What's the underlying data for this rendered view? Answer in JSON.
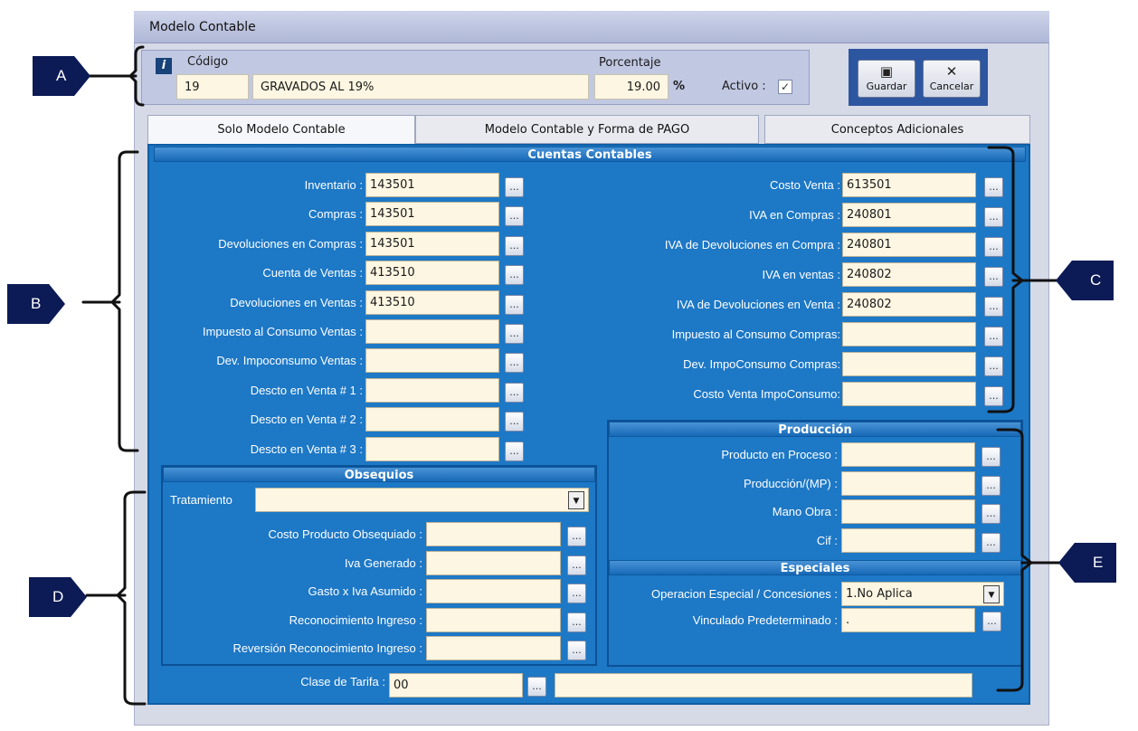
{
  "window": {
    "title": "Modelo Contable"
  },
  "header": {
    "codigo_label": "Código",
    "porcentaje_label": "Porcentaje",
    "codigo_value": "19",
    "descripcion_value": "GRAVADOS AL 19%",
    "porcentaje_value": "19.00",
    "percent_sign": "%",
    "activo_label": "Activo :",
    "activo_checked": true
  },
  "toolbar": {
    "save_label": "Guardar",
    "cancel_label": "Cancelar"
  },
  "tabs": [
    {
      "label": "Solo Modelo Contable",
      "active": true
    },
    {
      "label": "Modelo Contable y Forma de PAGO",
      "active": false
    },
    {
      "label": "Conceptos Adicionales",
      "active": false
    }
  ],
  "cuentas": {
    "title": "Cuentas Contables",
    "left": [
      {
        "label": "Inventario :",
        "value": "143501"
      },
      {
        "label": "Compras :",
        "value": "143501"
      },
      {
        "label": "Devoluciones en Compras :",
        "value": "143501"
      },
      {
        "label": "Cuenta de Ventas :",
        "value": "413510"
      },
      {
        "label": "Devoluciones en Ventas :",
        "value": "413510"
      },
      {
        "label": "Impuesto al Consumo Ventas :",
        "value": ""
      },
      {
        "label": "Dev. Impoconsumo Ventas :",
        "value": ""
      },
      {
        "label": "Descto en Venta # 1 :",
        "value": ""
      },
      {
        "label": "Descto en Venta # 2 :",
        "value": ""
      },
      {
        "label": "Descto en Venta # 3 :",
        "value": ""
      }
    ],
    "right": [
      {
        "label": "Costo Venta :",
        "value": "613501"
      },
      {
        "label": "IVA en Compras :",
        "value": "240801"
      },
      {
        "label": "IVA de Devoluciones en Compra :",
        "value": "240801"
      },
      {
        "label": "IVA en ventas :",
        "value": "240802"
      },
      {
        "label": "IVA de Devoluciones en Venta :",
        "value": "240802"
      },
      {
        "label": "Impuesto al Consumo Compras:",
        "value": ""
      },
      {
        "label": "Dev. ImpoConsumo Compras:",
        "value": ""
      },
      {
        "label": "Costo Venta ImpoConsumo:",
        "value": ""
      }
    ]
  },
  "obsequios": {
    "title": "Obsequios",
    "tratamiento_label": "Tratamiento",
    "tratamiento_value": "",
    "fields": [
      {
        "label": "Costo Producto Obsequiado :",
        "value": ""
      },
      {
        "label": "Iva Generado :",
        "value": ""
      },
      {
        "label": "Gasto x Iva Asumido :",
        "value": ""
      },
      {
        "label": "Reconocimiento Ingreso :",
        "value": ""
      },
      {
        "label": "Reversión Reconocimiento Ingreso :",
        "value": ""
      }
    ]
  },
  "produccion": {
    "title": "Producción",
    "fields": [
      {
        "label": "Producto en Proceso :",
        "value": ""
      },
      {
        "label": "Producción/(MP) :",
        "value": ""
      },
      {
        "label": "Mano Obra :",
        "value": ""
      },
      {
        "label": "Cif :",
        "value": ""
      }
    ]
  },
  "especiales": {
    "title": "Especiales",
    "operacion_label": "Operacion Especial / Concesiones :",
    "operacion_value": "1.No Aplica",
    "vinculado_label": "Vinculado Predeterminado :",
    "vinculado_value": "."
  },
  "tarifa": {
    "label": "Clase de Tarifa :",
    "value": "00",
    "description": ""
  },
  "ellipsis": "...",
  "markers": {
    "a": "A",
    "b": "B",
    "c": "C",
    "d": "D",
    "e": "E"
  },
  "colors": {
    "panel_blue": "#1d78c6",
    "input_bg": "#fdf6e2",
    "marker": "#0c1a55"
  }
}
